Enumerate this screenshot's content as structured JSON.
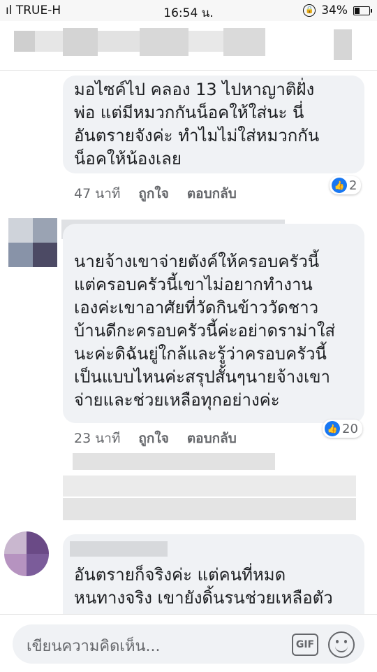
{
  "status_bar": {
    "carrier": "ıl TRUE-H",
    "time": "16:54 น.",
    "battery": "34%",
    "battery_level": 0.34
  },
  "comments": [
    {
      "text": "มอไซค์ไป คลอง 13 ไปหาญาติฝั่ง\nพ่อ แต่มีหมวกกันน็อคให้ใส่นะ นี่\nอันตรายจังค่ะ ทำไมไม่ใส่หมวกกัน\nน็อคให้น้องเลย",
      "time": "47 นาที",
      "like": "ถูกใจ",
      "reply": "ตอบกลับ",
      "reactions": "2"
    },
    {
      "text": "นายจ้างเขาจ่ายตังค์ให้ครอบครัวนี้\nแต่ครอบครัวนี้เขาไม่อยากทำงาน\nเองค่ะเขาอาศัยที่วัดกินข้าววัดชาว\nบ้านดีกะครอบครัวนี้ค่ะอย่าดราม่าใส่\nนะค่ะดิฉันยู่ใกล้และรู้ว่าครอบครัวนี้\nเป็นแบบไหนค่ะสรุปสั้นๆนายจ้างเขา\nจ่ายและช่วยเหลือทุกอย่างค่ะ",
      "time": "23 นาที",
      "like": "ถูกใจ",
      "reply": "ตอบกลับ",
      "reactions": "20"
    },
    {
      "text": "อันตรายก็จริงค่ะ แต่คนที่หมด\nหนทางจริง เขายังดิ้นรนช่วยเหลือตัว"
    }
  ],
  "composer": {
    "placeholder": "เขียนความคิดเห็น...",
    "gif_label": "GIF"
  },
  "icons": {
    "like": "thumbs-up-icon",
    "emoji": "smiley-icon",
    "gif": "gif-icon",
    "lock": "rotation-lock-icon",
    "battery": "battery-icon"
  },
  "colors": {
    "like_blue": "#1877f2",
    "bubble": "#f0f2f5",
    "meta": "#65676b"
  }
}
